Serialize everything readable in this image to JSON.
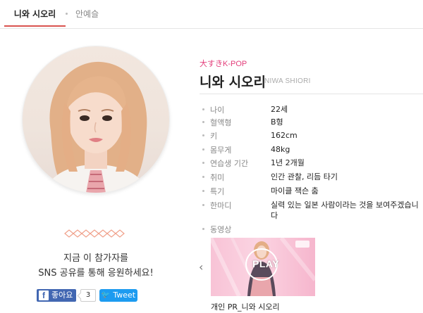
{
  "tabs": [
    {
      "label": "니와 시오리",
      "active": true
    },
    {
      "label": "안예슬",
      "active": false
    }
  ],
  "cta": {
    "line1": "지금 이 참가자를",
    "line2": "SNS 공유를 통해 응원하세요!"
  },
  "social": {
    "fb_like_label": "좋아요",
    "fb_count": "3",
    "tweet_label": "Tweet"
  },
  "profile": {
    "brand": "大すきK-POP",
    "name": "니와 시오리",
    "name_en": "NIWA SHIORI",
    "fields": [
      {
        "label": "나이",
        "value": "22세"
      },
      {
        "label": "혈액형",
        "value": "B형"
      },
      {
        "label": "키",
        "value": "162cm"
      },
      {
        "label": "몸무게",
        "value": "48kg"
      },
      {
        "label": "연습생 기간",
        "value": "1년 2개월"
      },
      {
        "label": "취미",
        "value": "인간 관찰, 리듬 타기"
      },
      {
        "label": "특기",
        "value": "마이클 잭슨 춤"
      },
      {
        "label": "한마디",
        "value": "실력 있는 일본 사람이라는 것을 보여주겠습니다"
      }
    ],
    "video_label": "동영상"
  },
  "video": {
    "play_text": "PLAY",
    "caption": "개인 PR_니와 시오리"
  },
  "colors": {
    "accent": "#d9534f",
    "brand": "#e33d7a",
    "facebook": "#4267b2",
    "twitter": "#1d9bf0"
  },
  "icons": [
    "facebook-icon",
    "twitter-bird-icon",
    "chevron-left-icon",
    "diamond-chain-icon"
  ]
}
